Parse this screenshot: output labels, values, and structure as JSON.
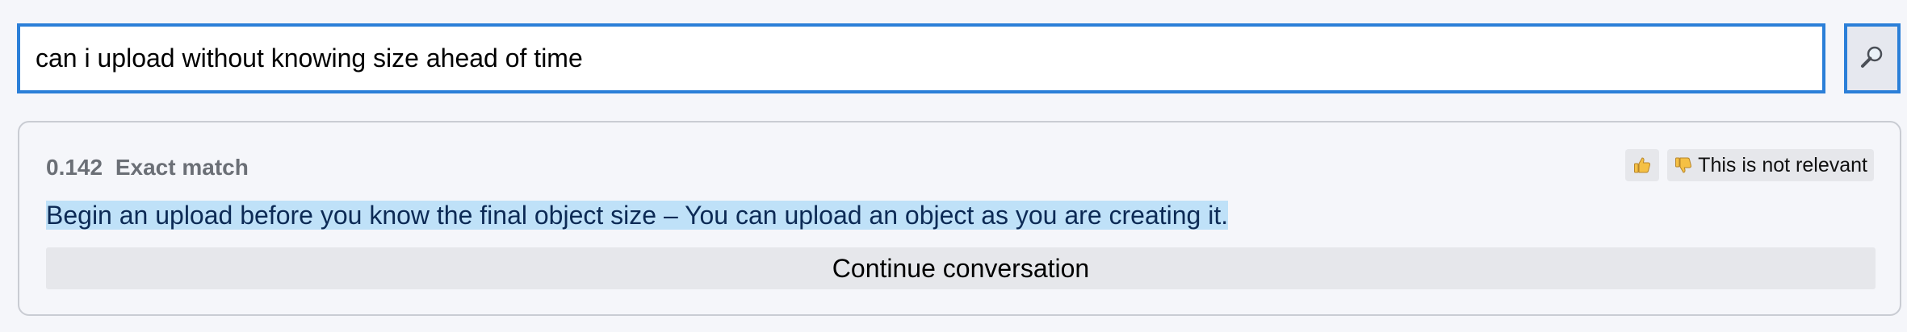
{
  "search": {
    "value": "can i upload without knowing size ahead of time",
    "button_icon": "magnifier-icon"
  },
  "result": {
    "score": "0.142",
    "match_type": "Exact match",
    "text": "Begin an upload before you know the final object size – You can upload an object as you are creating it.",
    "feedback": {
      "thumbs_up_icon": "thumbs-up-icon",
      "not_relevant_icon": "thumbs-down-icon",
      "not_relevant_label": "This is not relevant"
    },
    "continue_label": "Continue conversation"
  },
  "colors": {
    "accent": "#2b7fd8",
    "highlight": "#bfe1f8",
    "card_border": "#c9ccd3",
    "muted_text": "#6b6f76"
  }
}
